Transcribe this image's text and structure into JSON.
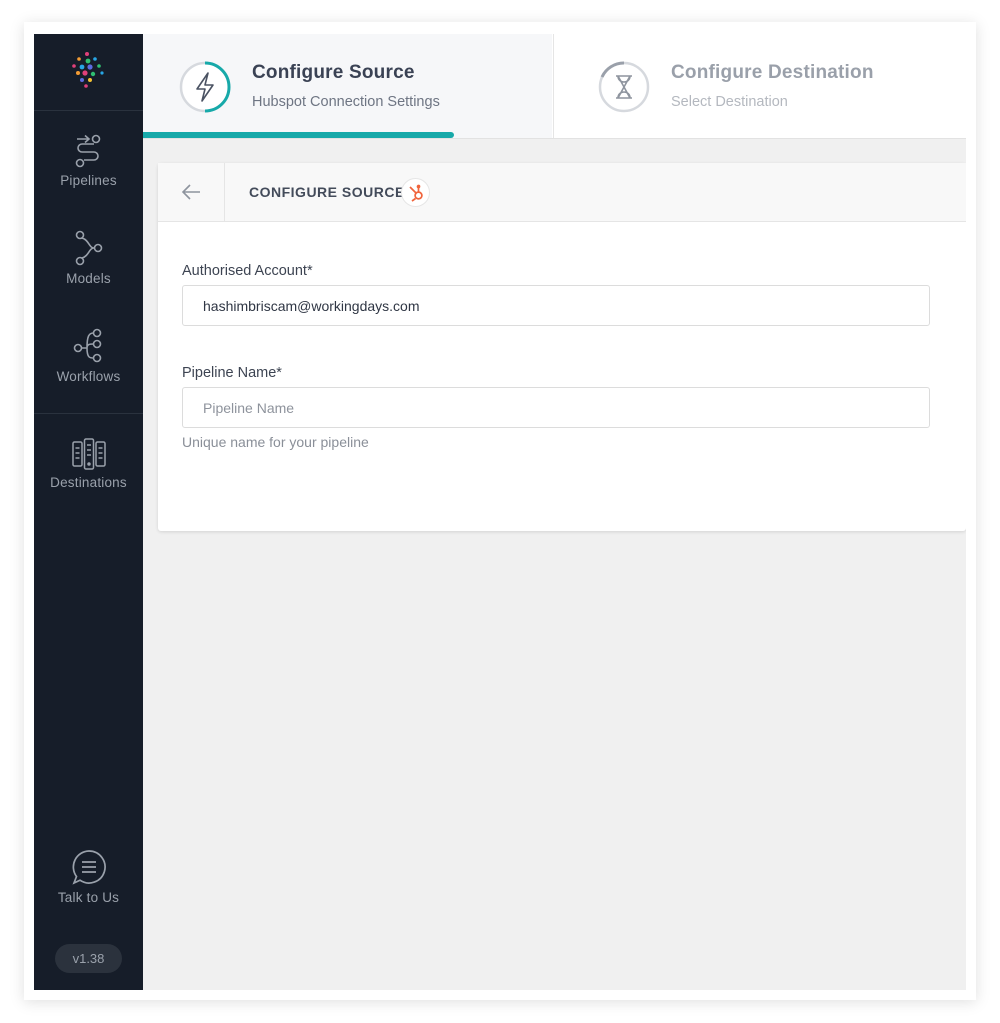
{
  "sidebar": {
    "items": [
      {
        "label": "Pipelines",
        "icon": "pipelines-icon"
      },
      {
        "label": "Models",
        "icon": "models-icon"
      },
      {
        "label": "Workflows",
        "icon": "workflows-icon"
      },
      {
        "label": "Destinations",
        "icon": "destinations-icon"
      }
    ],
    "talk": {
      "label": "Talk to Us",
      "icon": "chat-icon"
    },
    "version": "v1.38"
  },
  "stepper": {
    "steps": [
      {
        "title": "Configure Source",
        "subtitle": "Hubspot Connection Settings",
        "icon": "lightning-icon",
        "state": "active"
      },
      {
        "title": "Configure Destination",
        "subtitle": "Select Destination",
        "icon": "hourglass-icon",
        "state": "pending"
      }
    ]
  },
  "card": {
    "title": "CONFIGURE SOURCE",
    "source_icon": "hubspot-icon",
    "account": {
      "label": "Authorised Account*",
      "value": "hashimbriscam@workingdays.com"
    },
    "pipeline": {
      "label": "Pipeline Name*",
      "placeholder": "Pipeline Name",
      "help": "Unique name for your pipeline"
    }
  },
  "colors": {
    "sidebar_bg": "#161d29",
    "accent": "#17a9a9",
    "hubspot": "#f0643c"
  }
}
